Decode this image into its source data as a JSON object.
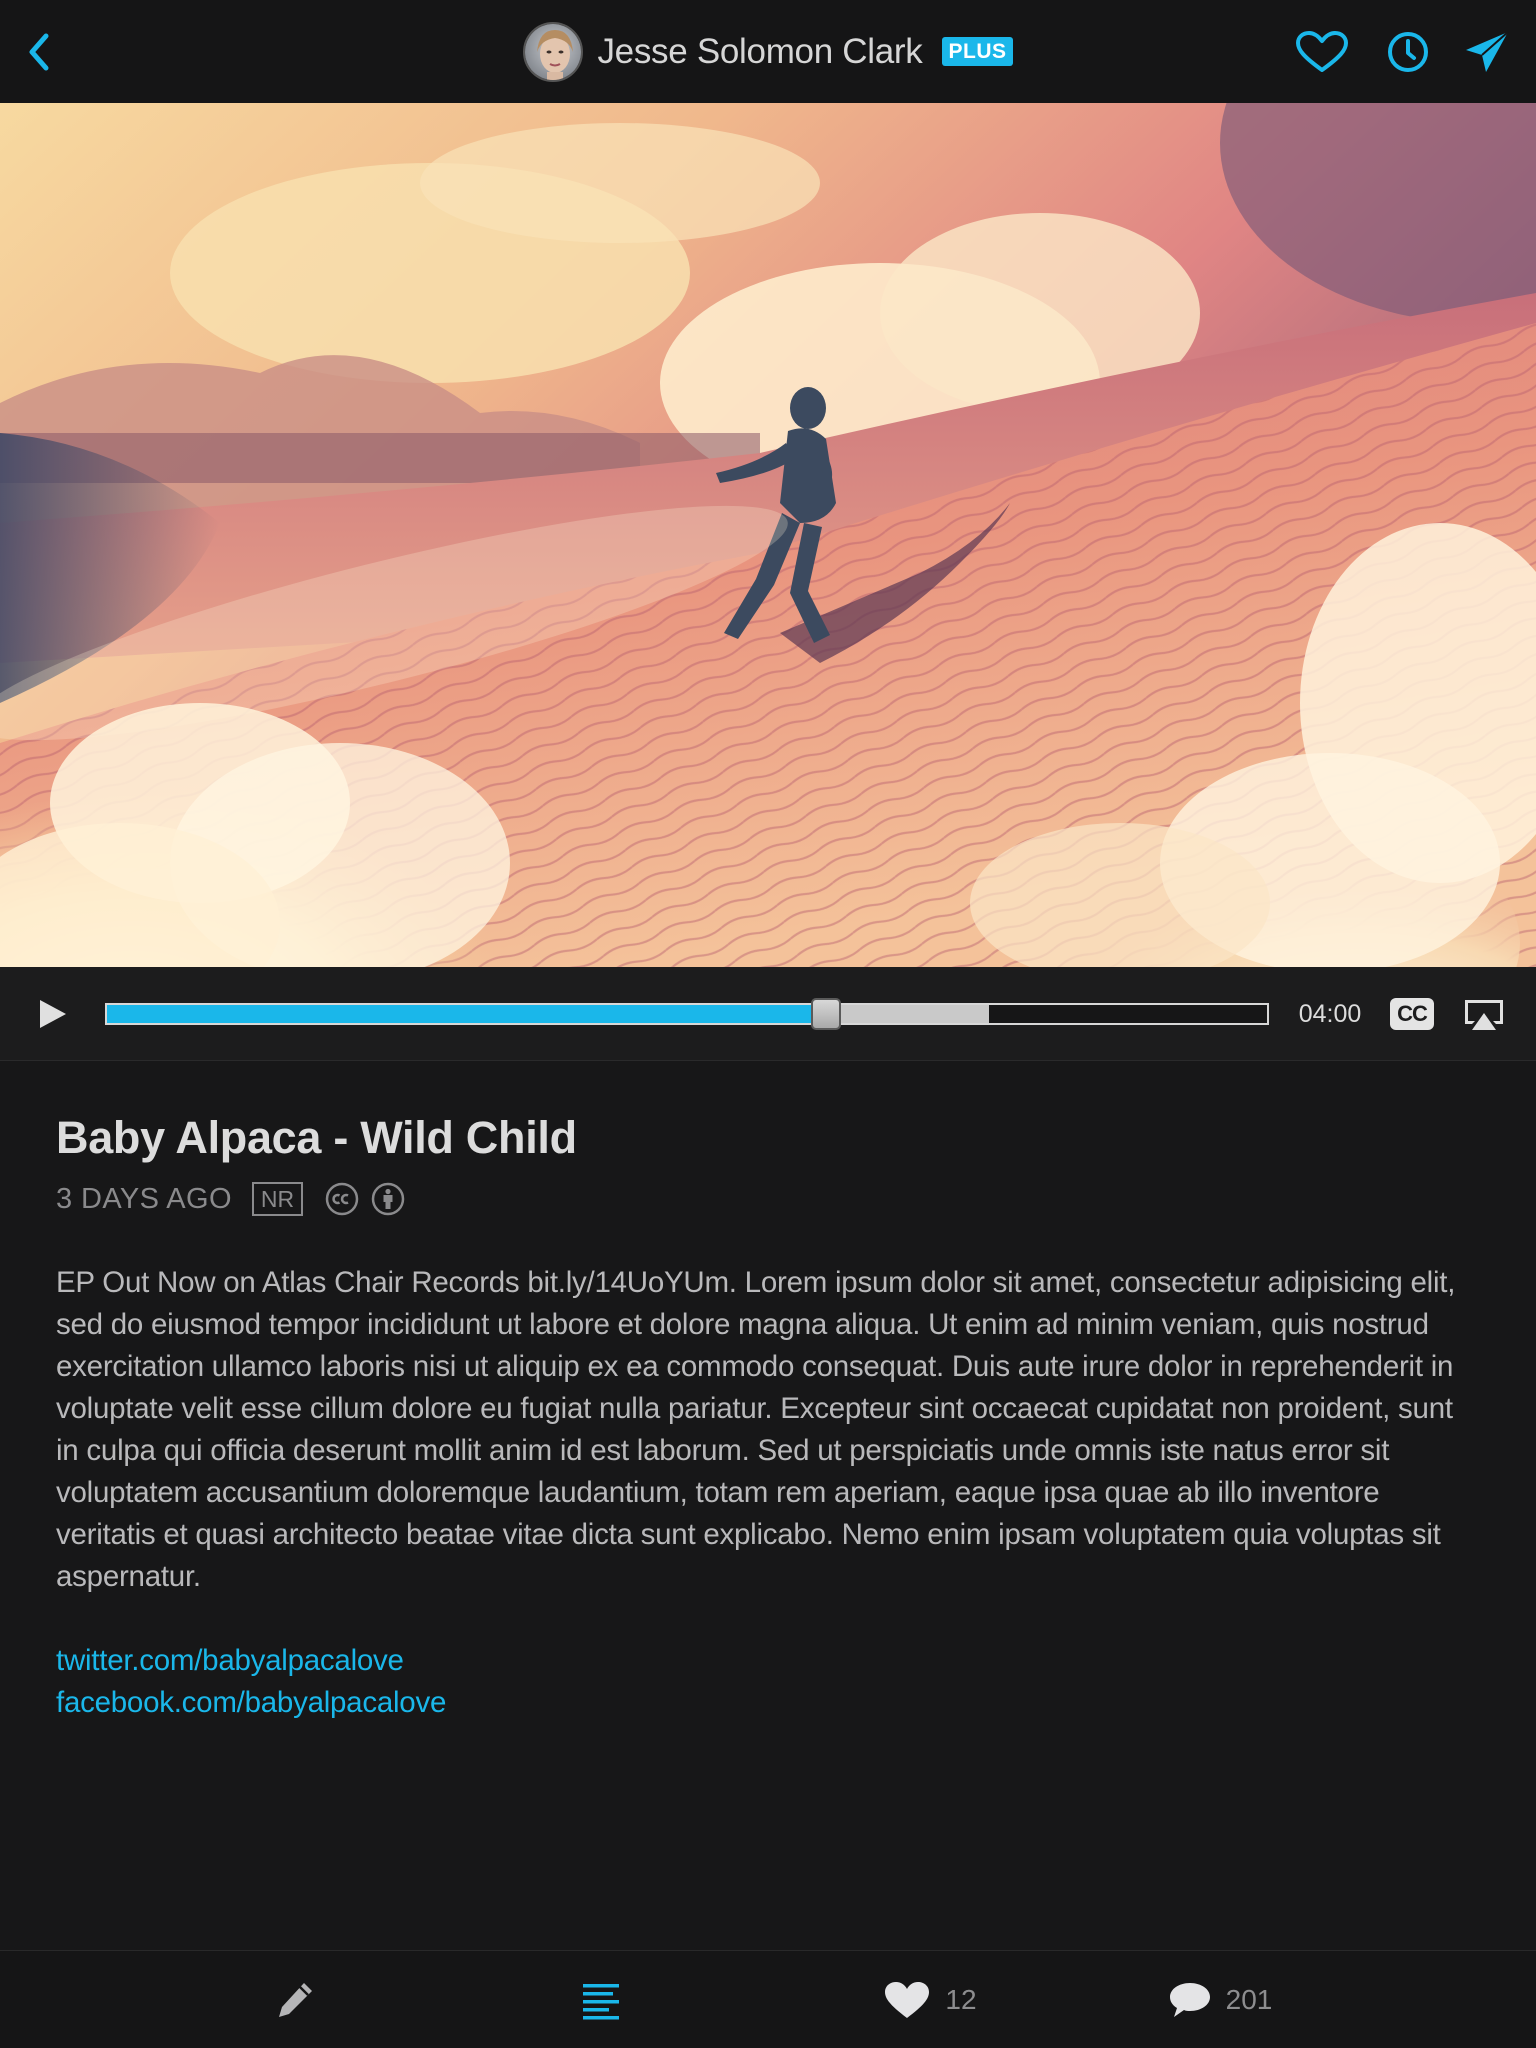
{
  "header": {
    "channel_name": "Jesse Solomon Clark",
    "badge": "PLUS"
  },
  "player": {
    "duration": "04:00",
    "progress_played": 0.62,
    "progress_buffered": 0.76,
    "cc_label": "CC"
  },
  "video": {
    "title": "Baby Alpaca - Wild Child",
    "posted": "3 DAYS AGO",
    "rating": "NR",
    "description": "EP Out Now on Atlas Chair Records bit.ly/14UoYUm. Lorem ipsum dolor sit amet, consectetur adipisicing elit, sed do eiusmod tempor incididunt ut labore et dolore magna aliqua. Ut enim ad minim veniam, quis nostrud exercitation ullamco laboris nisi ut aliquip ex ea commodo consequat. Duis aute irure dolor in reprehenderit in voluptate velit esse cillum dolore eu fugiat nulla pariatur. Excepteur sint occaecat cupidatat non proident, sunt in culpa qui officia deserunt mollit anim id est laborum. Sed ut perspiciatis unde omnis iste natus error sit voluptatem accusantium doloremque laudantium, totam rem aperiam, eaque ipsa quae ab illo inventore veritatis et quasi architecto beatae vitae dicta sunt explicabo. Nemo enim ipsam voluptatem quia voluptas sit aspernatur.",
    "links": [
      "twitter.com/babyalpacalove",
      "facebook.com/babyalpacalove"
    ]
  },
  "tabbar": {
    "likes_count": "12",
    "comments_count": "201"
  },
  "colors": {
    "accent": "#1ab7ea",
    "background": "#171718"
  },
  "icons": [
    "back-icon",
    "heart-icon",
    "clock-icon",
    "send-icon",
    "play-icon",
    "airplay-icon",
    "cc-license-icon",
    "attribution-icon",
    "pencil-icon",
    "description-icon",
    "heart-filled-icon",
    "comment-icon"
  ]
}
